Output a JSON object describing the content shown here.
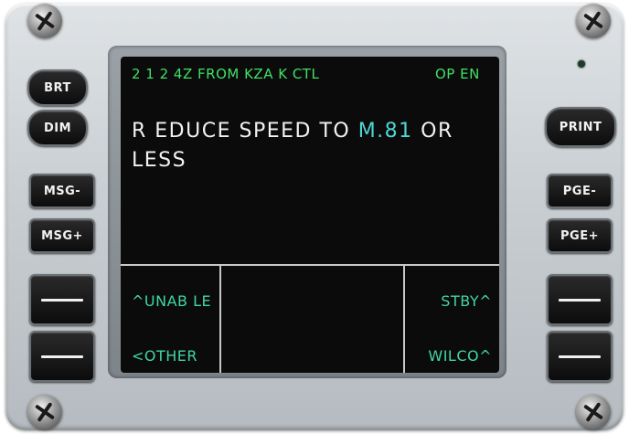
{
  "screen": {
    "header_left": "2 1 2 4Z FROM KZA K CTL",
    "header_right": "OP EN",
    "message_part1": "R EDUCE SPEED TO ",
    "message_highlight": "M.81",
    "message_part2": " OR",
    "message_line2": "LESS",
    "options": {
      "top_left": "^UNAB LE",
      "bottom_left": "<OTHER",
      "top_right": "STBY^",
      "bottom_right": "WILCO^"
    }
  },
  "buttons_left": {
    "brt": "BRT",
    "dim": "DIM",
    "msg_minus": "MSG-",
    "msg_plus": "MSG+"
  },
  "buttons_right": {
    "print": "PRINT",
    "pge_minus": "PGE-",
    "pge_plus": "PGE+"
  },
  "colors": {
    "header_text": "#3fe067",
    "message_text": "#f2f2f2",
    "highlight_text": "#4fd6d3",
    "option_text": "#3fd6a4"
  }
}
